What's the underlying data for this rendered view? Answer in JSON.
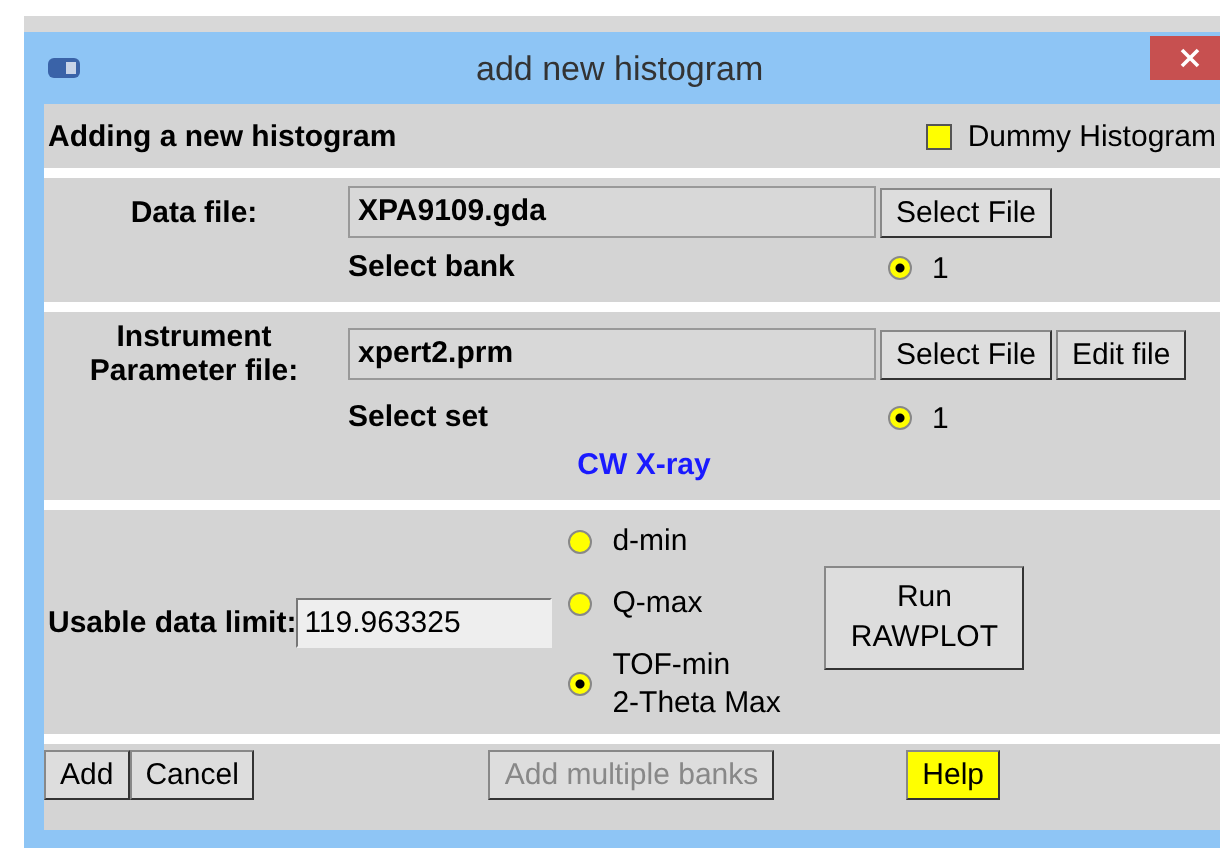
{
  "window": {
    "title": "add new histogram"
  },
  "header": {
    "title": "Adding a new histogram",
    "dummy": {
      "label": "Dummy Histogram",
      "checked": false
    }
  },
  "data_file": {
    "label": "Data file:",
    "value": "XPA9109.gda",
    "buttons": [
      "Select File"
    ],
    "select_label": "Select bank",
    "options": [
      {
        "label": "1",
        "selected": true
      }
    ]
  },
  "instrument": {
    "label_lines": [
      "Instrument",
      "Parameter file:"
    ],
    "value": "xpert2.prm",
    "buttons": [
      "Select File",
      "Edit file"
    ],
    "select_label": "Select set",
    "options": [
      {
        "label": "1",
        "selected": true
      }
    ],
    "type_note": "CW X-ray"
  },
  "limit": {
    "label": "Usable data limit:",
    "value": "119.963325",
    "options": [
      {
        "lines": [
          "d-min"
        ],
        "selected": false
      },
      {
        "lines": [
          "Q-max"
        ],
        "selected": false
      },
      {
        "lines": [
          "TOF-min",
          "2-Theta Max"
        ],
        "selected": true
      }
    ],
    "run_button": [
      "Run",
      "RAWPLOT"
    ]
  },
  "buttons": [
    {
      "label": "Add",
      "kind": "normal",
      "disabled": false
    },
    {
      "label": "Cancel",
      "kind": "normal",
      "disabled": false
    },
    {
      "label": "Add multiple banks",
      "kind": "wide",
      "disabled": true
    },
    {
      "label": "Help",
      "kind": "help",
      "disabled": false
    }
  ]
}
